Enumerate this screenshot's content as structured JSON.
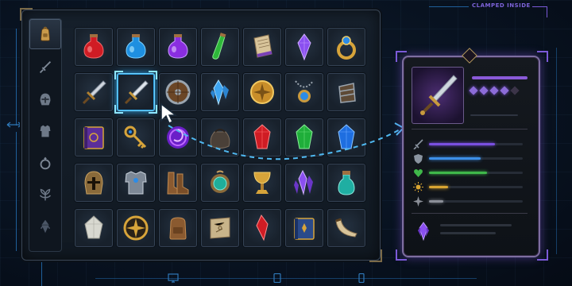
{
  "annotation": {
    "clamp_label": "CLAMPED INSIDE"
  },
  "inventory": {
    "categories": [
      {
        "name": "backpack",
        "active": true
      },
      {
        "name": "sword",
        "active": false
      },
      {
        "name": "helmet",
        "active": false
      },
      {
        "name": "armor",
        "active": false
      },
      {
        "name": "ring",
        "active": false
      },
      {
        "name": "herb",
        "active": false
      },
      {
        "name": "crystal",
        "active": false
      }
    ],
    "rows": [
      [
        "red-potion-icon",
        "blue-potion-icon",
        "purple-potion-icon",
        "green-vial-icon",
        "scroll-icon",
        "amethyst-crystal-icon",
        "sapphire-ring-icon"
      ],
      [
        "broadsword-icon",
        "sword-icon",
        "round-shield-icon",
        "ice-crystal-icon",
        "gold-compass-coin-icon",
        "sapphire-amulet-icon",
        "iron-gauntlet-icon"
      ],
      [
        "spellbook-icon",
        "gold-key-icon",
        "void-orb-icon",
        "coin-pouch-icon",
        "ruby-gem-icon",
        "emerald-gem-icon",
        "blue-gem-icon"
      ],
      [
        "knight-helmet-icon",
        "chest-armor-icon",
        "leather-boots-icon",
        "jade-amulet-icon",
        "golden-chalice-icon",
        "amethyst-cluster-icon",
        "teal-potion-icon"
      ],
      [
        "quartz-stone-icon",
        "compass-medallion-icon",
        "backpack-icon",
        "map-scroll-icon",
        "ruby-shard-icon",
        "blue-tome-icon",
        "war-horn-icon"
      ]
    ],
    "selected_slot": {
      "row": 1,
      "col": 1
    }
  },
  "tooltip": {
    "item_icon": "sword-icon",
    "rarity_pips_filled": 4,
    "rarity_pips_total": 5,
    "stats": [
      {
        "icon": "sword-stat-icon",
        "color": "#7a4fe0",
        "value": 0.7
      },
      {
        "icon": "shield-stat-icon",
        "color": "#3d8fe8",
        "value": 0.55
      },
      {
        "icon": "heart-stat-icon",
        "color": "#3fb84a",
        "value": 0.62
      },
      {
        "icon": "sun-stat-icon",
        "color": "#d9a532",
        "value": 0.2
      },
      {
        "icon": "star-stat-icon",
        "color": "#8b8f98",
        "value": 0.15
      }
    ],
    "footer_icon": "amethyst-crystal-icon"
  },
  "bottom_bar": {
    "icons": [
      "monitor-icon",
      "tablet-icon",
      "phone-icon"
    ]
  },
  "colors": {
    "accent_blue": "#2fa3e6",
    "accent_purple": "#7b5ad8",
    "frame_gold": "#b59a5e"
  }
}
